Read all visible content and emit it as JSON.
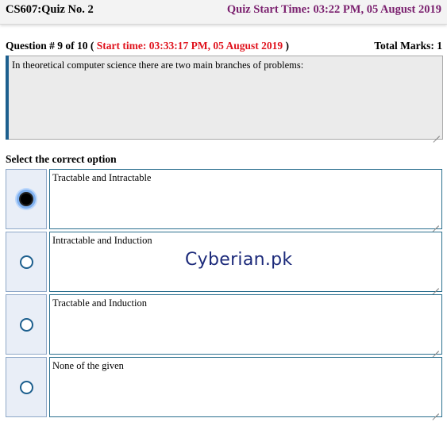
{
  "header": {
    "quiz_title": "CS607:Quiz No. 2",
    "quiz_start": "Quiz Start Time: 03:22 PM, 05 August 2019"
  },
  "question": {
    "number_prefix": "Question # 9 of 10 ( ",
    "start_time": "Start time: 03:33:17 PM, 05 August 2019",
    "number_suffix": " )",
    "total_marks": "Total Marks: 1",
    "text": "In theoretical computer science there are two main branches of problems:"
  },
  "select_label": "Select the correct option",
  "options": [
    {
      "label": "Tractable and Intractable",
      "selected": true
    },
    {
      "label": "Intractable and Induction",
      "selected": false
    },
    {
      "label": "Tractable and Induction",
      "selected": false
    },
    {
      "label": "None of the given",
      "selected": false
    }
  ],
  "watermark": "Cyberian.pk",
  "colors": {
    "start_time_red": "#e0141e",
    "quiz_start_purple": "#7a1f6e",
    "accent_blue": "#1d5f8e"
  }
}
